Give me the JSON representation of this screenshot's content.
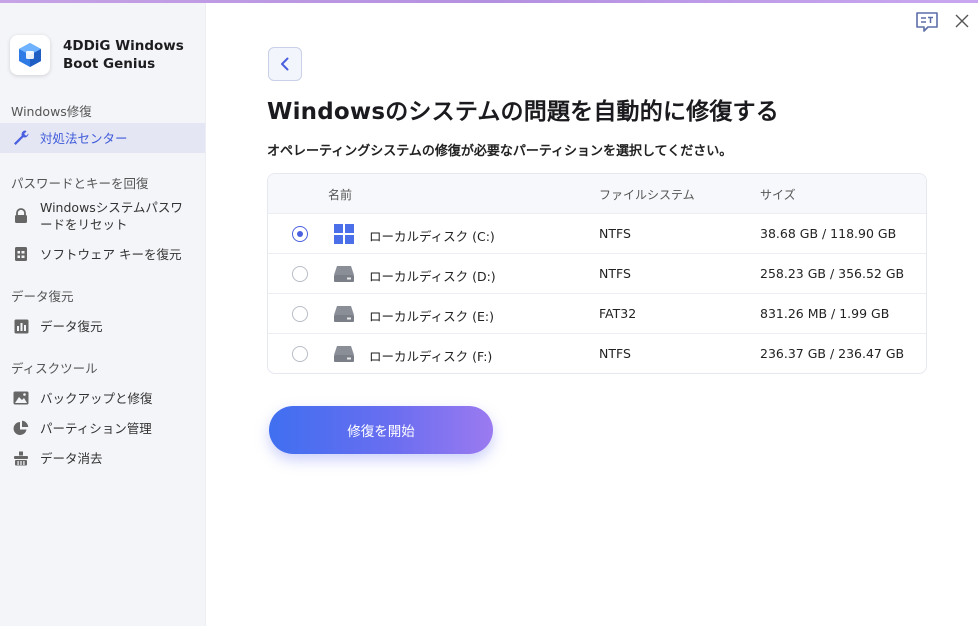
{
  "app": {
    "name": "4DDiG Windows Boot Genius"
  },
  "sidebar": {
    "sections": [
      {
        "title": "Windows修復",
        "items": [
          {
            "label": "対処法センター",
            "icon": "wrench-icon",
            "active": true
          }
        ]
      },
      {
        "title": "パスワードとキーを回復",
        "items": [
          {
            "label": "Windowsシステムパスワードをリセット",
            "icon": "lock-icon"
          },
          {
            "label": "ソフトウェア キーを復元",
            "icon": "key-doc-icon"
          }
        ]
      },
      {
        "title": "データ復元",
        "items": [
          {
            "label": "データ復元",
            "icon": "bar-chart-icon"
          }
        ]
      },
      {
        "title": "ディスクツール",
        "items": [
          {
            "label": "バックアップと修復",
            "icon": "image-backup-icon"
          },
          {
            "label": "パーティション管理",
            "icon": "pie-chart-icon"
          },
          {
            "label": "データ消去",
            "icon": "eraser-icon"
          }
        ]
      }
    ]
  },
  "main": {
    "title": "Windowsのシステムの問題を自動的に修復する",
    "subtitle": "オペレーティングシステムの修復が必要なパーティションを選択してください。",
    "table": {
      "headers": {
        "name": "名前",
        "fs": "ファイルシステム",
        "size": "サイズ"
      },
      "rows": [
        {
          "name": "ローカルディスク (C:)",
          "fs": "NTFS",
          "size": "38.68 GB / 118.90 GB",
          "selected": true,
          "icon": "windows-logo-icon"
        },
        {
          "name": "ローカルディスク (D:)",
          "fs": "NTFS",
          "size": "258.23 GB / 356.52 GB",
          "selected": false,
          "icon": "hard-drive-icon"
        },
        {
          "name": "ローカルディスク (E:)",
          "fs": "FAT32",
          "size": "831.26 MB / 1.99 GB",
          "selected": false,
          "icon": "hard-drive-icon"
        },
        {
          "name": "ローカルディスク (F:)",
          "fs": "NTFS",
          "size": "236.37 GB / 236.47 GB",
          "selected": false,
          "icon": "hard-drive-icon"
        }
      ]
    },
    "start_button": "修復を開始"
  },
  "colors": {
    "accent": "#4a5fe0",
    "gradient_start": "#3f6ff0",
    "gradient_end": "#9b7af0",
    "sidebar_bg": "#f4f5f9"
  }
}
